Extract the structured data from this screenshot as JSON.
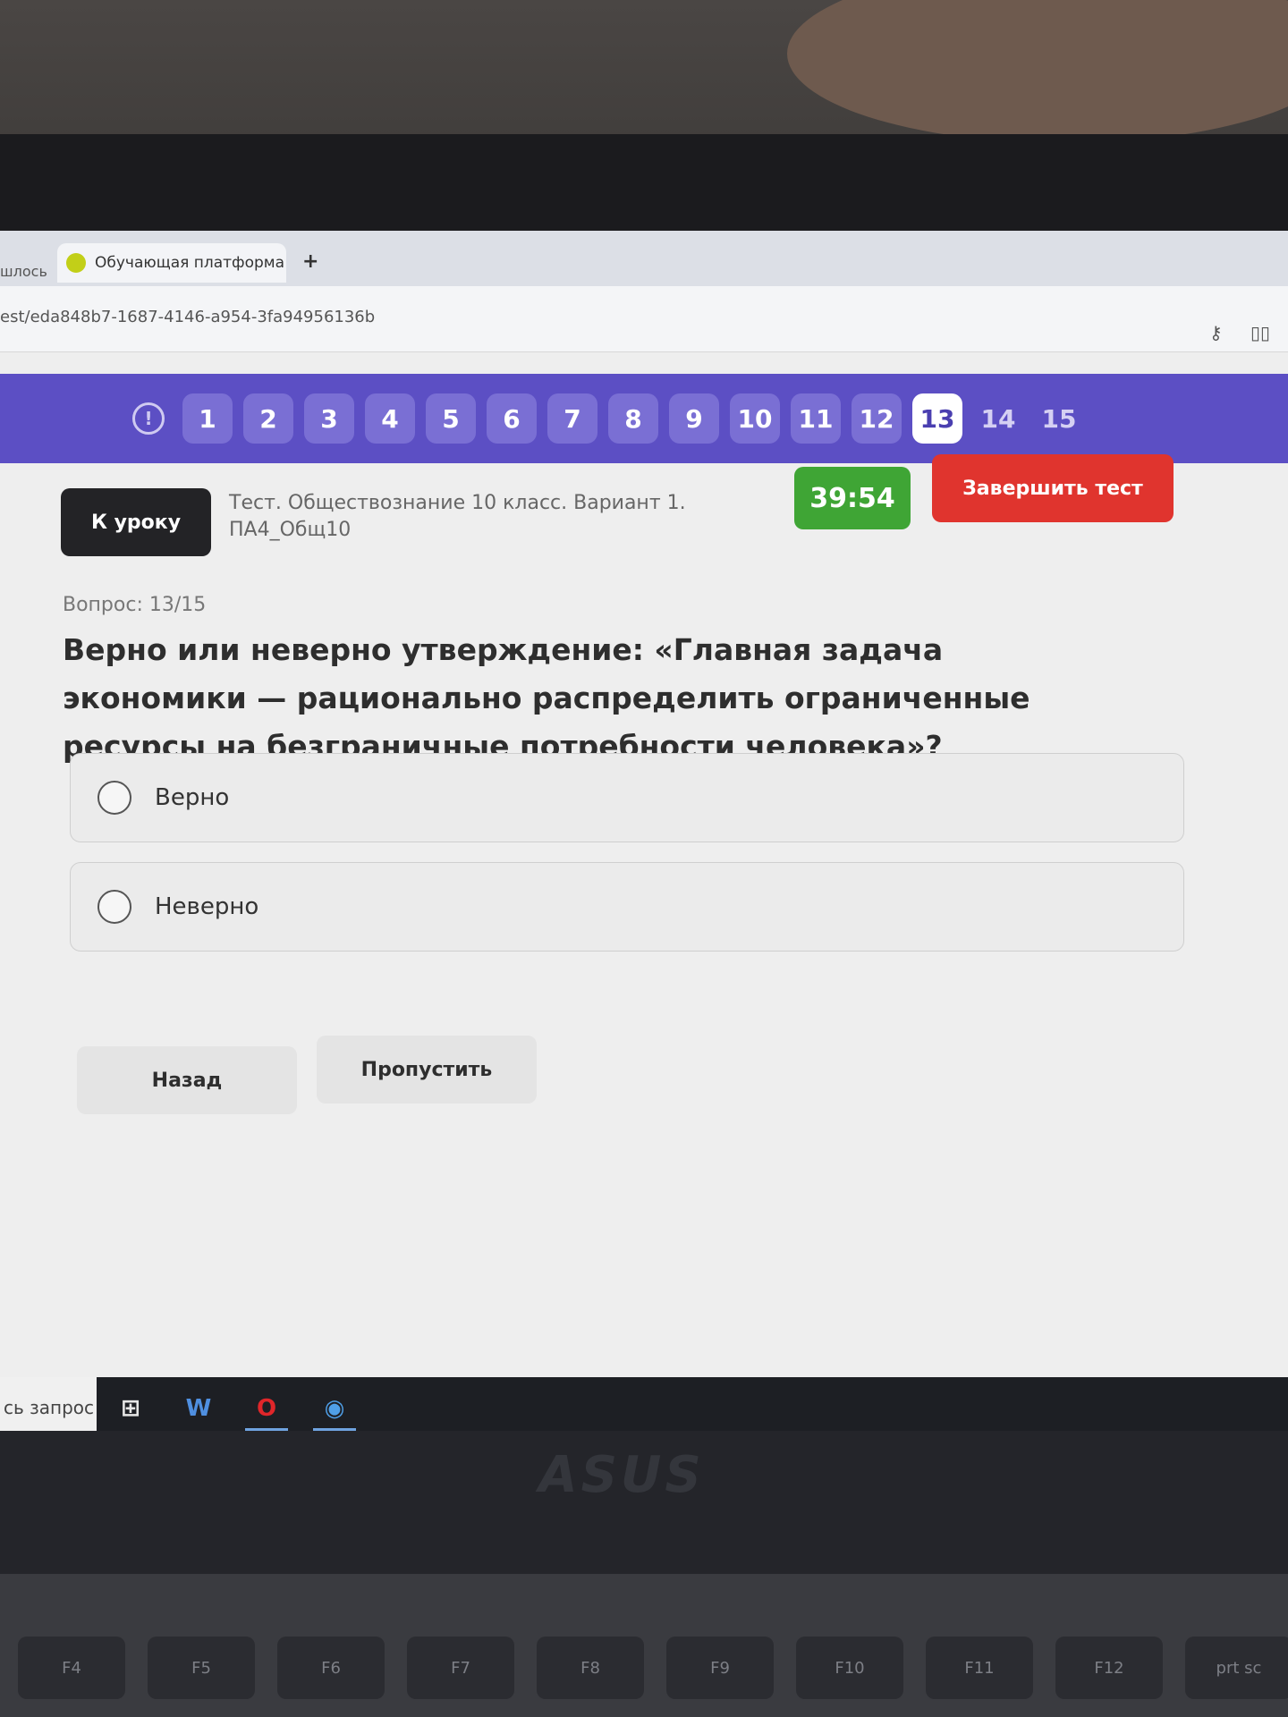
{
  "browser": {
    "prev_tab_label": "шлось",
    "active_tab_title": "Обучающая платформа",
    "new_tab_symbol": "+",
    "url": "est/eda848b7-1687-4146-a954-3fa94956136b"
  },
  "question_nav": {
    "warning_symbol": "!",
    "numbers": [
      "1",
      "2",
      "3",
      "4",
      "5",
      "6",
      "7",
      "8",
      "9",
      "10",
      "11",
      "12",
      "13",
      "14",
      "15"
    ],
    "current": "13"
  },
  "header": {
    "back_button": "К уроку",
    "test_title_line1": "Тест. Обществознание 10 класс. Вариант 1.",
    "test_title_line2": "ПА4_Общ10",
    "timer": "39:54",
    "finish_button": "Завершить тест"
  },
  "question": {
    "counter": "Вопрос: 13/15",
    "text": "Верно или неверно утверждение: «Главная задача экономики — рационально распределить ограниченные ресурсы на безграничные потребности человека»?",
    "options": [
      "Верно",
      "Неверно"
    ]
  },
  "actions": {
    "back": "Назад",
    "skip": "Пропустить"
  },
  "taskbar": {
    "search_placeholder": "сь запрос",
    "icons": [
      "task-view-icon",
      "word-icon",
      "opera-icon",
      "browser-icon"
    ]
  },
  "device": {
    "logo": "ASUS",
    "fkeys": [
      "F4",
      "F5",
      "F6",
      "F7",
      "F8",
      "F9",
      "F10",
      "F11",
      "F12",
      "prt sc"
    ]
  },
  "colors": {
    "nav_bar": "#5c4fc4",
    "timer": "#3fa535",
    "finish": "#e0342e",
    "back_button": "#232326"
  }
}
